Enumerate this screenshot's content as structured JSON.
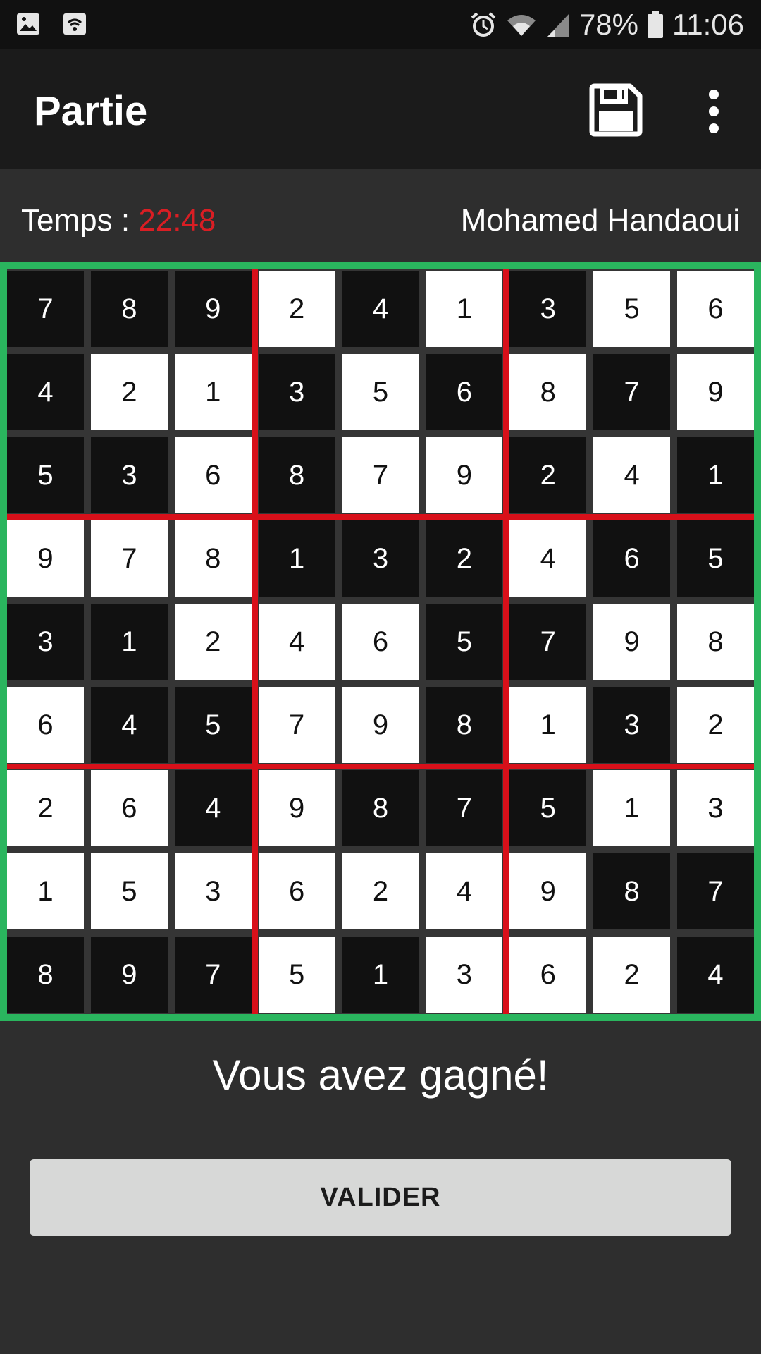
{
  "statusbar": {
    "battery": "78%",
    "time": "11:06",
    "icons": [
      "image-icon",
      "wifi-hotspot-icon",
      "alarm-icon",
      "wifi-icon",
      "signal-icon",
      "battery-icon"
    ]
  },
  "appbar": {
    "title": "Partie",
    "save_icon": "floppy-save-icon",
    "menu_icon": "overflow-menu-icon"
  },
  "info": {
    "time_label": "Temps : ",
    "time_value": "22:48",
    "player": "Mohamed Handaoui"
  },
  "colors": {
    "background": "#2e2e2e",
    "appbar": "#1b1b1b",
    "statusbar": "#111111",
    "board_border": "#2ab55e",
    "block_separator": "#d8101a",
    "time_color": "#d91e24",
    "cell_dark": "#111111",
    "cell_light": "#ffffff",
    "button_bg": "#d7d8d7"
  },
  "grid": {
    "values": [
      [
        7,
        8,
        9,
        2,
        4,
        1,
        3,
        5,
        6
      ],
      [
        4,
        2,
        1,
        3,
        5,
        6,
        8,
        7,
        9
      ],
      [
        5,
        3,
        6,
        8,
        7,
        9,
        2,
        4,
        1
      ],
      [
        9,
        7,
        8,
        1,
        3,
        2,
        4,
        6,
        5
      ],
      [
        3,
        1,
        2,
        4,
        6,
        5,
        7,
        9,
        8
      ],
      [
        6,
        4,
        5,
        7,
        9,
        8,
        1,
        3,
        2
      ],
      [
        2,
        6,
        4,
        9,
        8,
        7,
        5,
        1,
        3
      ],
      [
        1,
        5,
        3,
        6,
        2,
        4,
        9,
        8,
        7
      ],
      [
        8,
        9,
        7,
        5,
        1,
        3,
        6,
        2,
        4
      ]
    ],
    "fills": [
      "bbbwbwbww",
      "bwwbwbwbw",
      "bbwbwwbwb",
      "wwwbbbwbb",
      "bbwwwbbww",
      "wbbwwbwbw",
      "wwbwbbbww",
      "wwwwwwwbb",
      "bbbwbwwwb"
    ]
  },
  "message": "Vous avez gagné!",
  "validate_label": "VALIDER"
}
